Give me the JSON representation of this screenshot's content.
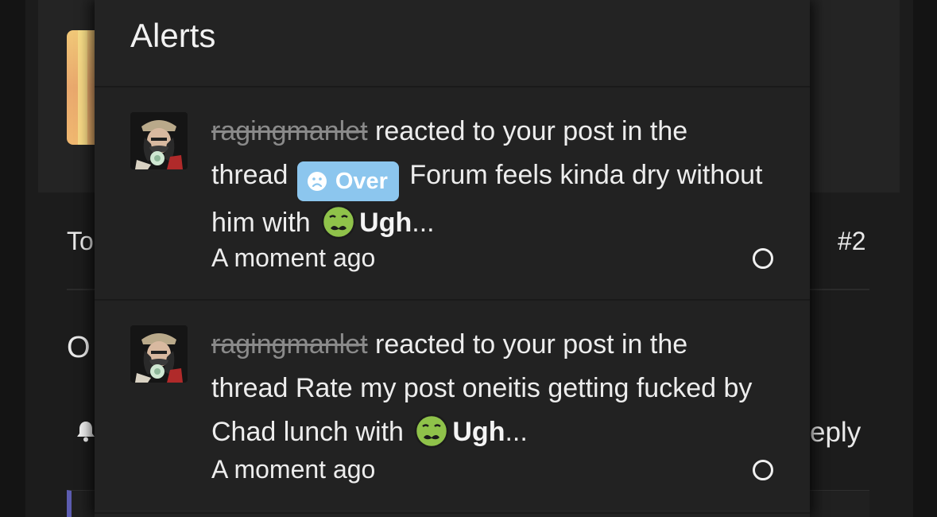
{
  "background": {
    "thread_starter_prefix": "To",
    "post_number": "#2",
    "post_start_letter": "O",
    "reply_fragment": "eply",
    "icons": [
      "bell-icon"
    ]
  },
  "alerts_panel": {
    "title": "Alerts",
    "items": [
      {
        "username": "ragingmanlet",
        "action_text": " reacted to your post in the thread ",
        "prefix_label": "Over",
        "prefix_icon": "frown-face-icon",
        "thread_title": " Forum feels kinda dry without him",
        "with_text": " with ",
        "reaction_icon": "nauseated-face-icon",
        "reaction_name": "Ugh",
        "ellipsis": "...",
        "time": "A moment ago",
        "read_marker_icon": "circle-outline-icon"
      },
      {
        "username": "ragingmanlet",
        "action_text": " reacted to your post in the thread ",
        "thread_title": "Rate my post oneitis getting fucked by Chad lunch",
        "with_text": " with ",
        "reaction_icon": "nauseated-face-icon",
        "reaction_name": "Ugh",
        "ellipsis": "...",
        "time": "A moment ago",
        "read_marker_icon": "circle-outline-icon"
      }
    ]
  },
  "colors": {
    "panel_bg": "#222222",
    "prefix_badge": "#8cc6ee",
    "username_struck": "#8a8a8a",
    "quote_accent": "#5c5cb0"
  }
}
